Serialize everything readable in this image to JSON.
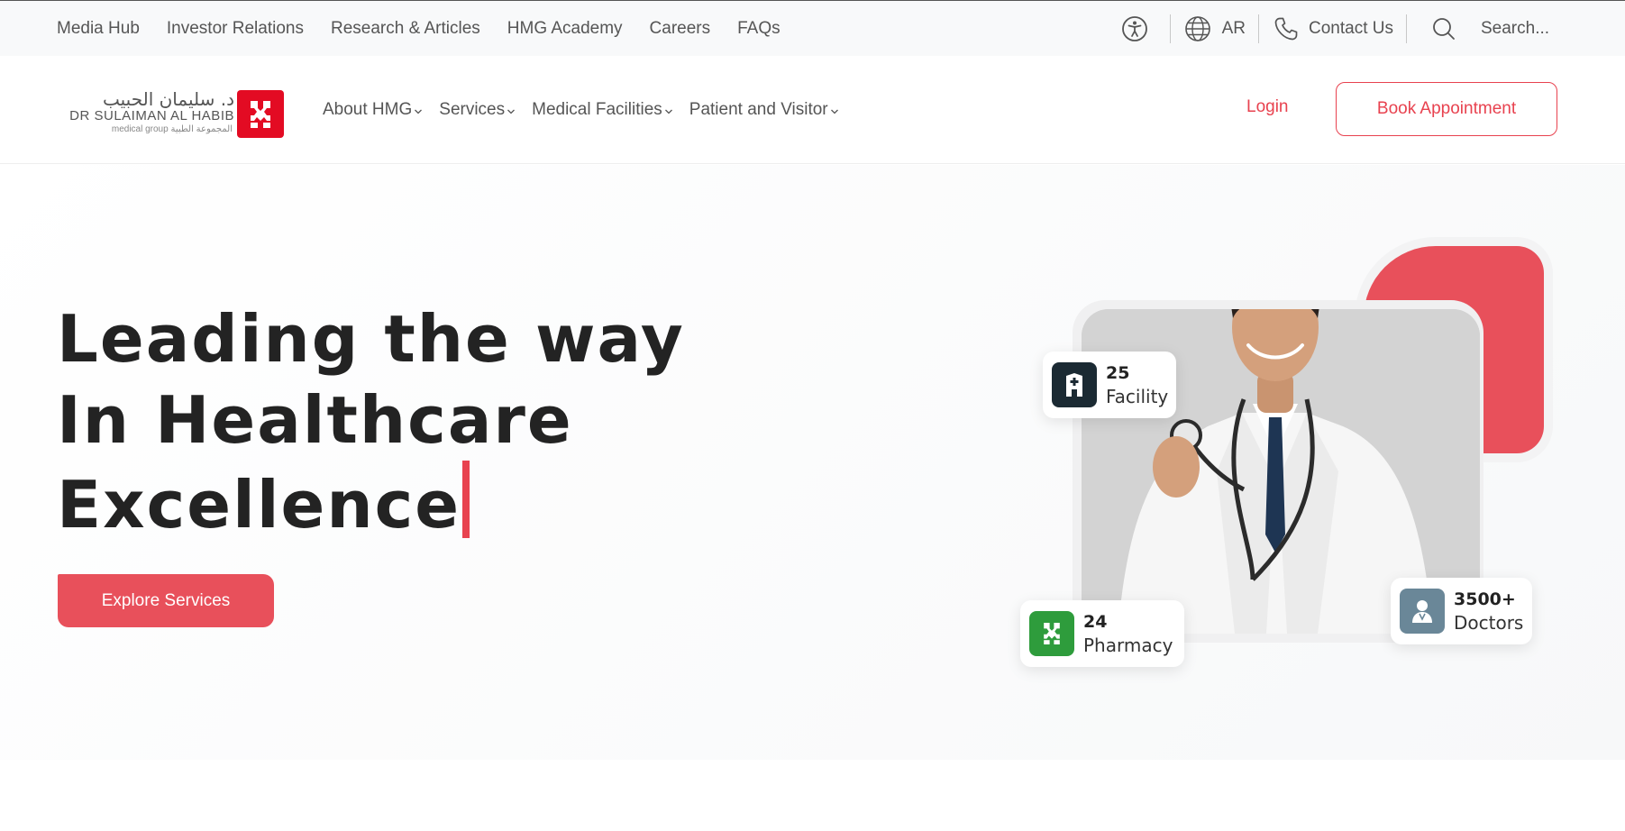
{
  "colors": {
    "accent": "#e8424f",
    "text_dark": "#232323",
    "pharmacy_green": "#2e9c3c",
    "facility_dark": "#1b2a33",
    "doctors_slate": "#6a8798"
  },
  "topbar": {
    "links": [
      {
        "label": "Media Hub"
      },
      {
        "label": "Investor Relations"
      },
      {
        "label": "Research & Articles"
      },
      {
        "label": "HMG Academy"
      },
      {
        "label": "Careers"
      },
      {
        "label": "FAQs"
      }
    ],
    "language_label": "AR",
    "contact_label": "Contact Us",
    "search_placeholder": "Search..."
  },
  "header": {
    "logo": {
      "arabic_name": "د. سليمان الحبيب",
      "english_name": "DR SULAIMAN AL HABIB",
      "sub_line": "medical group المجموعة الطبية"
    },
    "nav": [
      {
        "label": "About HMG"
      },
      {
        "label": "Services"
      },
      {
        "label": "Medical Facilities"
      },
      {
        "label": "Patient and Visitor"
      }
    ],
    "login_label": "Login",
    "book_label": "Book Appointment"
  },
  "hero": {
    "headline_lines": [
      "Leading the way",
      "In Healthcare",
      "Excellence"
    ],
    "cta_label": "Explore Services",
    "stats": {
      "facility": {
        "value": "25",
        "label": "Facility",
        "icon": "hospital-icon"
      },
      "pharmacy": {
        "value": "24",
        "label": "Pharmacy",
        "icon": "pharmacy-icon"
      },
      "doctors": {
        "value": "3500+",
        "label": "Doctors",
        "icon": "doctor-icon"
      }
    }
  }
}
